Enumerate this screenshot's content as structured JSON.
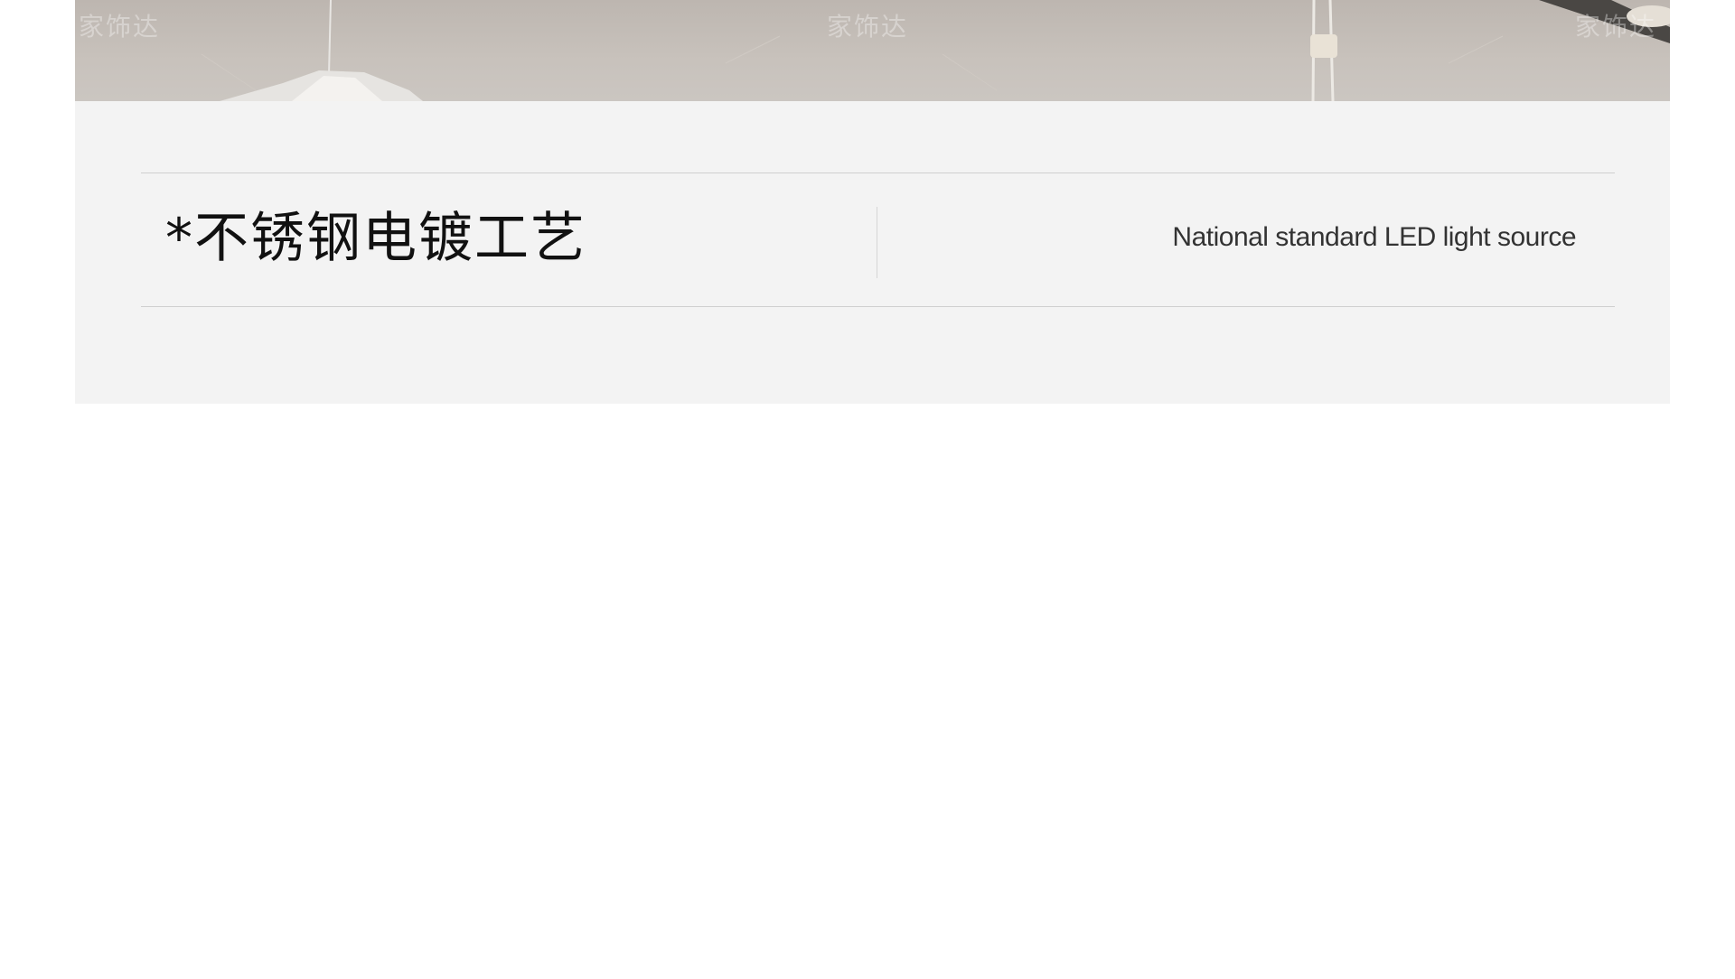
{
  "banner": {
    "watermarks": [
      "家饰达",
      "家饰达",
      "家饰达"
    ]
  },
  "feature": {
    "title_cn": "*不锈钢电镀工艺",
    "subtitle_en": "National standard LED light source"
  },
  "colors": {
    "panel_bg": "#f3f3f3",
    "page_bg": "#ffffff",
    "rule": "#cfcfcf",
    "title_text": "#111111",
    "subtitle_text": "#333333"
  }
}
